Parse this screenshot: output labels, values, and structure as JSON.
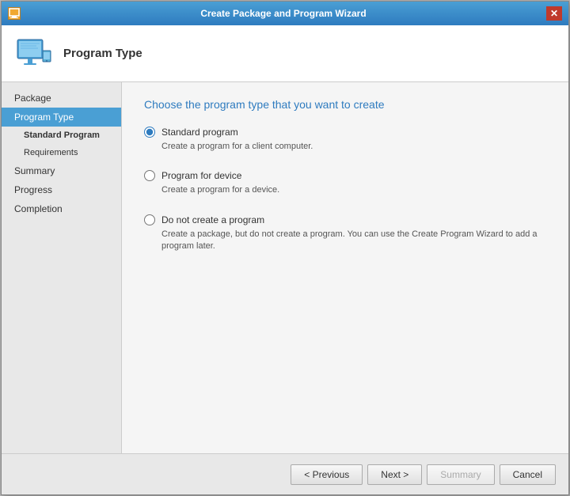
{
  "window": {
    "title": "Create Package and Program Wizard",
    "close_label": "✕"
  },
  "header": {
    "title": "Program Type"
  },
  "sidebar": {
    "items": [
      {
        "id": "package",
        "label": "Package",
        "active": false,
        "sub": false,
        "bold": false
      },
      {
        "id": "program-type",
        "label": "Program Type",
        "active": true,
        "sub": false,
        "bold": false
      },
      {
        "id": "standard-program",
        "label": "Standard Program",
        "active": false,
        "sub": true,
        "bold": true
      },
      {
        "id": "requirements",
        "label": "Requirements",
        "active": false,
        "sub": true,
        "bold": false
      },
      {
        "id": "summary",
        "label": "Summary",
        "active": false,
        "sub": false,
        "bold": false
      },
      {
        "id": "progress",
        "label": "Progress",
        "active": false,
        "sub": false,
        "bold": false
      },
      {
        "id": "completion",
        "label": "Completion",
        "active": false,
        "sub": false,
        "bold": false
      }
    ]
  },
  "main": {
    "heading": "Choose the program type that you want to create",
    "radio_options": [
      {
        "id": "standard",
        "label": "Standard program",
        "description": "Create a program for a client computer.",
        "checked": true
      },
      {
        "id": "device",
        "label": "Program for device",
        "description": "Create a program for a device.",
        "checked": false
      },
      {
        "id": "no-program",
        "label": "Do not create a program",
        "description": "Create a package, but do not create a program. You can use the Create Program Wizard to add a program later.",
        "checked": false
      }
    ]
  },
  "footer": {
    "previous_label": "< Previous",
    "next_label": "Next >",
    "summary_label": "Summary",
    "cancel_label": "Cancel"
  }
}
